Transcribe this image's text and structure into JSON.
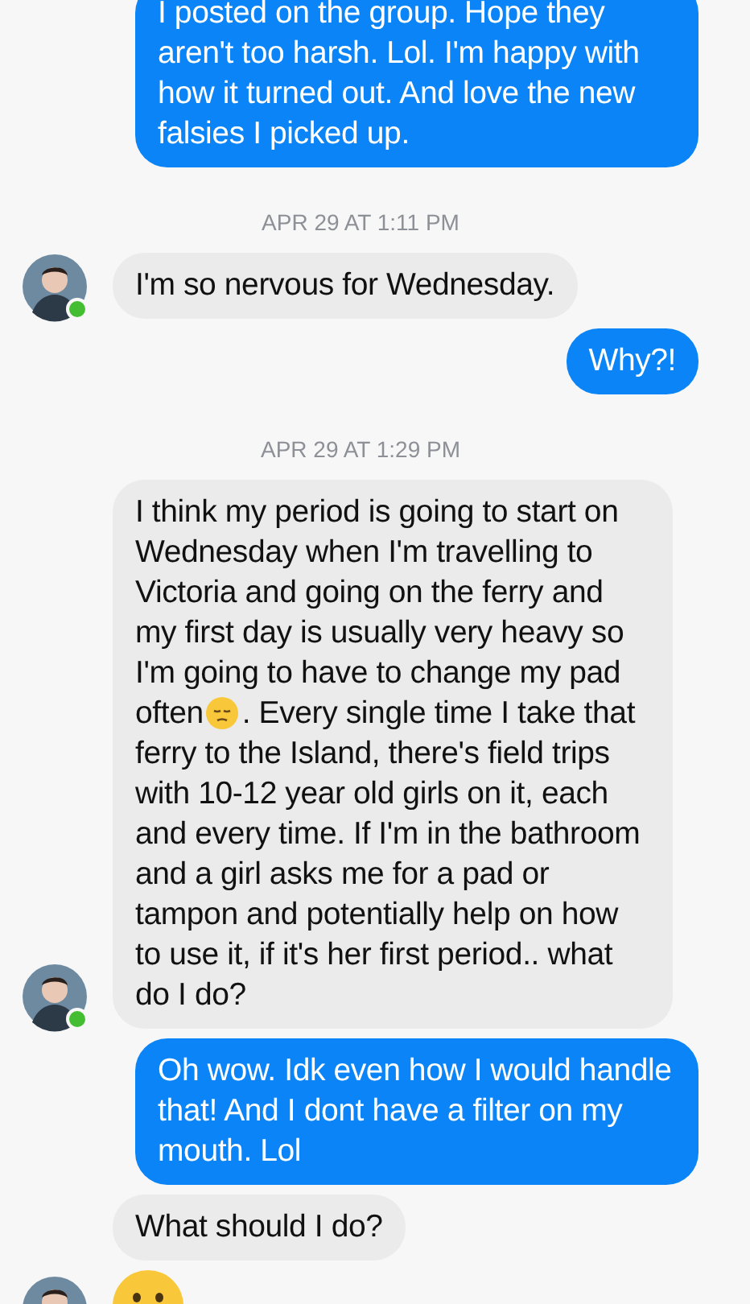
{
  "messages": [
    {
      "kind": "out",
      "text": "I posted on the group. Hope they aren't too harsh. Lol. I'm happy with how it turned out. And love the new falsies I picked up."
    },
    {
      "kind": "time",
      "text": "APR 29 AT 1:11 PM"
    },
    {
      "kind": "in",
      "text": "I'm so nervous for Wednesday.",
      "avatar": true,
      "online": true
    },
    {
      "kind": "out",
      "text": "Why?!"
    },
    {
      "kind": "time",
      "text": "APR 29 AT 1:29 PM"
    },
    {
      "kind": "in",
      "text": "I think my period is going to start on Wednesday when I'm travelling to Victoria and going on the ferry and my first day is usually very heavy so I'm going to have to change my pad often",
      "text_after": ". Every single time I take that ferry to the Island, there's field trips with 10-12 year old girls on it, each and every time. If I'm in the bathroom and a girl asks me for a pad or tampon and potentially help on how to use it, if it's her first period.. what do I do?",
      "avatar": true,
      "online": true
    },
    {
      "kind": "out",
      "text": "Oh wow. Idk even how I would handle that! And I dont have a filter on my mouth. Lol"
    },
    {
      "kind": "in",
      "text": "What should I do?",
      "avatar": false
    },
    {
      "kind": "emoji",
      "avatar": true
    }
  ]
}
